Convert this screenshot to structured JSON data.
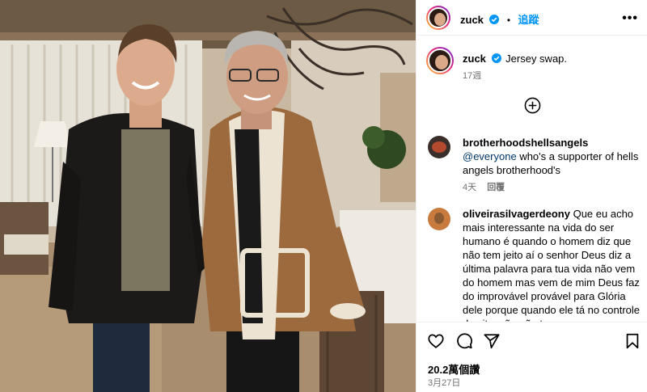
{
  "post": {
    "author": "zuck",
    "follow_label": "追蹤",
    "dot": "•",
    "more_label": "•••",
    "caption": "Jersey swap.",
    "caption_time": "17週"
  },
  "comments": [
    {
      "user": "brotherhoodshellsangels",
      "text": "@everyone who's a supporter of hells angels brotherhood's",
      "mention": "@everyone",
      "body": "who's a supporter of hells angels brotherhood's",
      "time": "4天",
      "reply_label": "回覆"
    },
    {
      "user": "oliveirasilvagerdeony",
      "text": "Que eu acho mais interessante na vida do ser humano é quando o homem diz que não tem jeito aí o senhor Deus diz a última palavra para tua vida não vem do homem mas vem de mim Deus faz do improvável provável para Glória dele porque quando ele tá no controle da situação não tem quem"
    }
  ],
  "footer": {
    "likes": "20.2萬個讚",
    "date": "3月27日"
  },
  "icons": {
    "verified": "verified-badge-icon",
    "load_more": "plus-circle-icon",
    "like": "heart-icon",
    "comment": "comment-bubble-icon",
    "share": "paper-plane-icon",
    "save": "bookmark-icon"
  },
  "colors": {
    "link": "#0095f6",
    "meta": "#737373",
    "divider": "#efefef"
  }
}
